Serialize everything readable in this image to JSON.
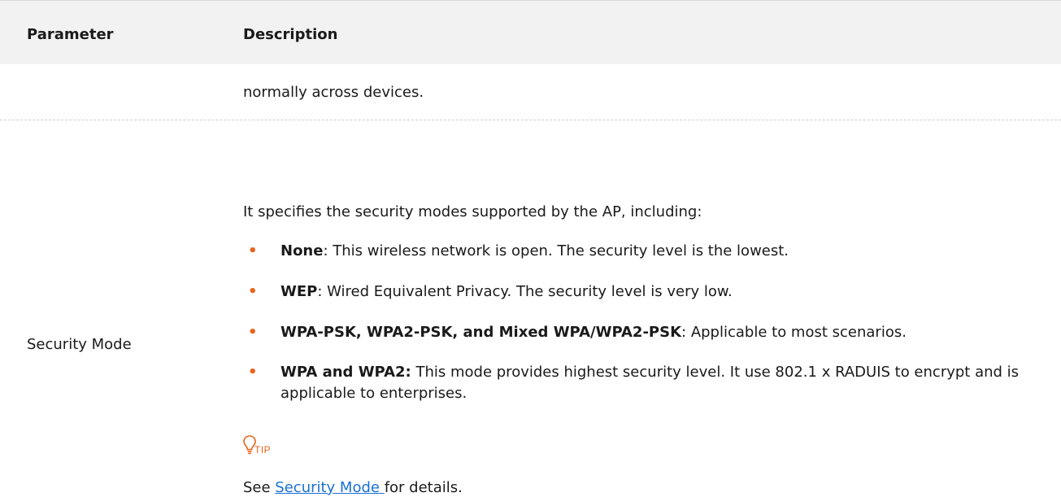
{
  "table": {
    "headers": {
      "parameter": "Parameter",
      "description": "Description"
    },
    "continued_text": "normally across devices.",
    "rows": [
      {
        "parameter": "Security Mode",
        "intro": "It specifies the security modes supported by the AP, including:",
        "bullets": [
          {
            "term": "None",
            "text": ": This wireless network is open. The security level is the lowest."
          },
          {
            "term": "WEP",
            "text": ": Wired Equivalent Privacy. The security level is very low."
          },
          {
            "term": "WPA-PSK, WPA2-PSK, and Mixed WPA/WPA2-PSK",
            "text": ": Applicable to most scenarios."
          },
          {
            "term": "WPA and WPA2:",
            "text": " This mode provides highest security level. It use 802.1 x RADUIS to encrypt and is applicable to enterprises."
          }
        ],
        "tip_label": "TIP",
        "see_prefix": "See ",
        "see_link": "Security Mode ",
        "see_suffix": "for details."
      }
    ]
  },
  "colors": {
    "accent": "#e8641b",
    "link": "#1a6fd6",
    "header_bg": "#f2f2f2"
  },
  "icons": {
    "tip": "lightbulb-icon",
    "bullet": "bullet-dot-icon"
  }
}
